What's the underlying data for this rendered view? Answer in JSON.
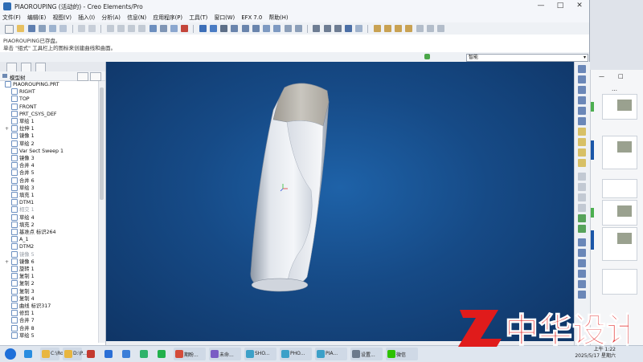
{
  "window": {
    "title": "PIAOROUPING (活动的) - Creo Elements/Pro",
    "controls": [
      "—",
      "□",
      "✕"
    ]
  },
  "menu": [
    "文件(F)",
    "编辑(E)",
    "视图(V)",
    "插入(I)",
    "分析(A)",
    "信息(N)",
    "应用程序(P)",
    "工具(T)",
    "窗口(W)",
    "EFX 7.0",
    "帮助(H)"
  ],
  "messages": [
    "PIAOROUPING已存盘。",
    "单击 \"组式\" 工具栏上的图标来创建曲线和曲面。"
  ],
  "filter": {
    "value": "智能"
  },
  "tree": {
    "header": "模型树",
    "items": [
      {
        "label": "PIAOROUPING.PRT",
        "icon": "part-icon",
        "dim": false,
        "expand": ""
      },
      {
        "label": "RIGHT",
        "icon": "datum-plane-icon",
        "dim": false,
        "expand": ""
      },
      {
        "label": "TOP",
        "icon": "datum-plane-icon",
        "dim": false,
        "expand": ""
      },
      {
        "label": "FRONT",
        "icon": "datum-plane-icon",
        "dim": false,
        "expand": ""
      },
      {
        "label": "PRT_CSYS_DEF",
        "icon": "csys-icon",
        "dim": false,
        "expand": ""
      },
      {
        "label": "草绘 1",
        "icon": "sketch-icon",
        "dim": false,
        "expand": ""
      },
      {
        "label": "拉伸 1",
        "icon": "extrude-icon",
        "dim": false,
        "expand": "+"
      },
      {
        "label": "镜像 1",
        "icon": "mirror-icon",
        "dim": false,
        "expand": ""
      },
      {
        "label": "草绘 2",
        "icon": "sketch-icon",
        "dim": false,
        "expand": ""
      },
      {
        "label": "Var Sect Sweep 1",
        "icon": "sweep-icon",
        "dim": false,
        "expand": ""
      },
      {
        "label": "镜像 3",
        "icon": "mirror-icon",
        "dim": false,
        "expand": ""
      },
      {
        "label": "合并 4",
        "icon": "merge-icon",
        "dim": false,
        "expand": ""
      },
      {
        "label": "合并 5",
        "icon": "merge-icon",
        "dim": false,
        "expand": ""
      },
      {
        "label": "合并 6",
        "icon": "merge-icon",
        "dim": false,
        "expand": ""
      },
      {
        "label": "草绘 3",
        "icon": "sketch-icon",
        "dim": false,
        "expand": ""
      },
      {
        "label": "填充 1",
        "icon": "fill-icon",
        "dim": false,
        "expand": ""
      },
      {
        "label": "DTM1",
        "icon": "datum-plane-icon",
        "dim": false,
        "expand": ""
      },
      {
        "label": "相交 1",
        "icon": "intersect-icon",
        "dim": true,
        "expand": ""
      },
      {
        "label": "草绘 4",
        "icon": "sketch-icon",
        "dim": false,
        "expand": ""
      },
      {
        "label": "填充 2",
        "icon": "fill-icon",
        "dim": false,
        "expand": ""
      },
      {
        "label": "基准点 标识264",
        "icon": "datum-point-icon",
        "dim": false,
        "expand": ""
      },
      {
        "label": "A_1",
        "icon": "axis-icon",
        "dim": false,
        "expand": ""
      },
      {
        "label": "DTM2",
        "icon": "datum-plane-icon",
        "dim": false,
        "expand": ""
      },
      {
        "label": "镜像 5",
        "icon": "mirror-icon",
        "dim": true,
        "expand": ""
      },
      {
        "label": "镜像 6",
        "icon": "mirror-icon",
        "dim": false,
        "expand": "+"
      },
      {
        "label": "旋转 1",
        "icon": "revolve-icon",
        "dim": false,
        "expand": ""
      },
      {
        "label": "复制 1",
        "icon": "copy-icon",
        "dim": false,
        "expand": ""
      },
      {
        "label": "复制 2",
        "icon": "copy-icon",
        "dim": false,
        "expand": ""
      },
      {
        "label": "复制 3",
        "icon": "copy-icon",
        "dim": false,
        "expand": ""
      },
      {
        "label": "复制 4",
        "icon": "copy-icon",
        "dim": false,
        "expand": ""
      },
      {
        "label": "曲线 标识317",
        "icon": "curve-icon",
        "dim": false,
        "expand": ""
      },
      {
        "label": "修剪 1",
        "icon": "trim-icon",
        "dim": false,
        "expand": ""
      },
      {
        "label": "合并 7",
        "icon": "merge-icon",
        "dim": false,
        "expand": ""
      },
      {
        "label": "合并 8",
        "icon": "merge-icon",
        "dim": false,
        "expand": ""
      },
      {
        "label": "草绘 5",
        "icon": "sketch-icon",
        "dim": false,
        "expand": ""
      }
    ]
  },
  "taskbar": {
    "items": [
      {
        "label": "",
        "icon": "windows-start-icon",
        "color": "#1e6fd9"
      },
      {
        "label": "",
        "icon": "browser-icon",
        "color": "#2a8de0"
      },
      {
        "label": "C:\\Ro...",
        "icon": "folder-icon",
        "color": "#e8b640"
      },
      {
        "label": "D:\\P...",
        "icon": "folder-icon",
        "color": "#e8b640"
      },
      {
        "label": "",
        "icon": "app-icon",
        "color": "#c43a2f"
      },
      {
        "label": "",
        "icon": "k-icon",
        "color": "#2a6fd6"
      },
      {
        "label": "",
        "icon": "cloud-icon",
        "color": "#3b7ed8"
      },
      {
        "label": "",
        "icon": "video-icon",
        "color": "#2fb36b"
      },
      {
        "label": "",
        "icon": "iqiyi-icon",
        "color": "#22b14c"
      },
      {
        "label": "期盼...",
        "icon": "app-icon",
        "color": "#d44c3a"
      },
      {
        "label": "未命...",
        "icon": "app-icon",
        "color": "#7a5cc4"
      },
      {
        "label": "SHO...",
        "icon": "app-icon",
        "color": "#3ca0c8"
      },
      {
        "label": "PHO...",
        "icon": "app-icon",
        "color": "#3ca0c8"
      },
      {
        "label": "PIA...",
        "icon": "creo-icon",
        "color": "#3ca0c8"
      },
      {
        "label": "设置...",
        "icon": "gear-icon",
        "color": "#6c7a8c"
      },
      {
        "label": "微信",
        "icon": "wechat-icon",
        "color": "#2dc100"
      }
    ],
    "time": "上午 1:22",
    "date": "2025/5/17 星期六"
  },
  "watermark": {
    "text": "中华设计",
    "color": "#e01b1b"
  }
}
